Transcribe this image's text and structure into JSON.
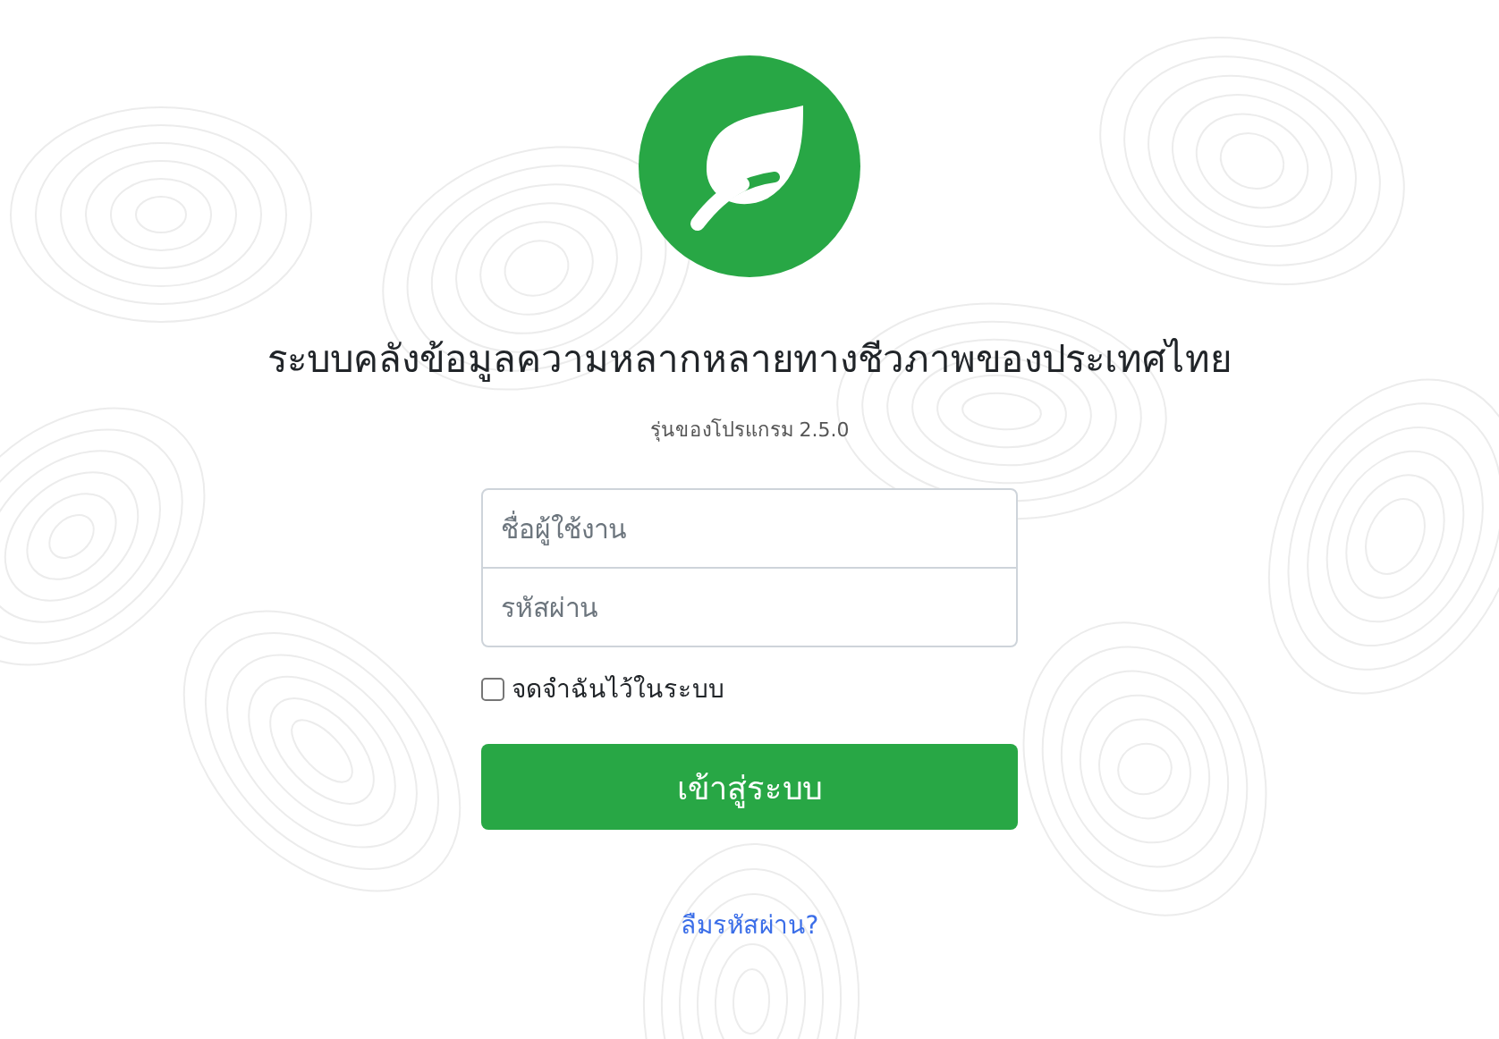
{
  "title": "ระบบคลังข้อมูลความหลากหลายทางชีวภาพของประเทศไทย",
  "version": "รุ่นของโปรแกรม 2.5.0",
  "form": {
    "username": {
      "placeholder": "ชื่อผู้ใช้งาน"
    },
    "password": {
      "placeholder": "รหัสผ่าน"
    },
    "remember": {
      "label": "จดจำฉันไว้ในระบบ",
      "checked": false
    },
    "submit": "เข้าสู่ระบบ"
  },
  "forgot_link": "ลืมรหัสผ่าน?"
}
